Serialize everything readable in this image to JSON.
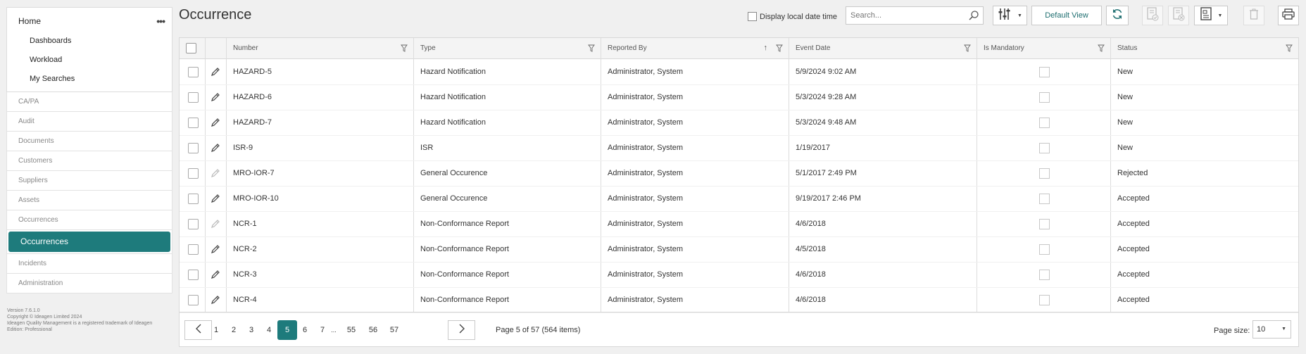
{
  "sidebar": {
    "home_label": "Home",
    "home_children": [
      "Dashboards",
      "Workload",
      "My Searches"
    ],
    "nav_items": [
      "CA/PA",
      "Audit",
      "Documents",
      "Customers",
      "Suppliers",
      "Assets",
      "Occurrences"
    ],
    "active_item": "Occurrences",
    "bottom_items": [
      "Incidents",
      "Administration"
    ],
    "version_lines": [
      "Version 7.6.1.0",
      "Copyright © Ideagen Limited 2024",
      "Ideagen Quality Management is a registered trademark of Ideagen",
      "Edition: Professional"
    ]
  },
  "header": {
    "title": "Occurrence",
    "local_datetime_label": "Display local date time",
    "search_placeholder": "Search...",
    "default_view_label": "Default View"
  },
  "grid": {
    "columns": [
      "Number",
      "Type",
      "Reported By",
      "Event Date",
      "Is Mandatory",
      "Status"
    ],
    "sorted_column": "Reported By",
    "sort_direction": "ascending",
    "rows": [
      {
        "number": "HAZARD-5",
        "type": "Hazard Notification",
        "reported_by": "Administrator, System",
        "event_date": "5/9/2024 9:02 AM",
        "status": "New",
        "editable": true
      },
      {
        "number": "HAZARD-6",
        "type": "Hazard Notification",
        "reported_by": "Administrator, System",
        "event_date": "5/3/2024 9:28 AM",
        "status": "New",
        "editable": true
      },
      {
        "number": "HAZARD-7",
        "type": "Hazard Notification",
        "reported_by": "Administrator, System",
        "event_date": "5/3/2024 9:48 AM",
        "status": "New",
        "editable": true
      },
      {
        "number": "ISR-9",
        "type": "ISR",
        "reported_by": "Administrator, System",
        "event_date": "1/19/2017",
        "status": "New",
        "editable": true
      },
      {
        "number": "MRO-IOR-7",
        "type": "General Occurence",
        "reported_by": "Administrator, System",
        "event_date": "5/1/2017 2:49 PM",
        "status": "Rejected",
        "editable": false
      },
      {
        "number": "MRO-IOR-10",
        "type": "General Occurence",
        "reported_by": "Administrator, System",
        "event_date": "9/19/2017 2:46 PM",
        "status": "Accepted",
        "editable": true
      },
      {
        "number": "NCR-1",
        "type": "Non-Conformance Report",
        "reported_by": "Administrator, System",
        "event_date": "4/6/2018",
        "status": "Accepted",
        "editable": false
      },
      {
        "number": "NCR-2",
        "type": "Non-Conformance Report",
        "reported_by": "Administrator, System",
        "event_date": "4/5/2018",
        "status": "Accepted",
        "editable": true
      },
      {
        "number": "NCR-3",
        "type": "Non-Conformance Report",
        "reported_by": "Administrator, System",
        "event_date": "4/6/2018",
        "status": "Accepted",
        "editable": true
      },
      {
        "number": "NCR-4",
        "type": "Non-Conformance Report",
        "reported_by": "Administrator, System",
        "event_date": "4/6/2018",
        "status": "Accepted",
        "editable": true
      }
    ]
  },
  "pager": {
    "pages": [
      "1",
      "2",
      "3",
      "4",
      "5",
      "6",
      "7",
      "...",
      "55",
      "56",
      "57"
    ],
    "current_page": "5",
    "info": "Page 5 of 57 (564 items)",
    "page_size_label": "Page size:",
    "page_size": "10"
  },
  "colors": {
    "accent": "#1e7b7c"
  }
}
